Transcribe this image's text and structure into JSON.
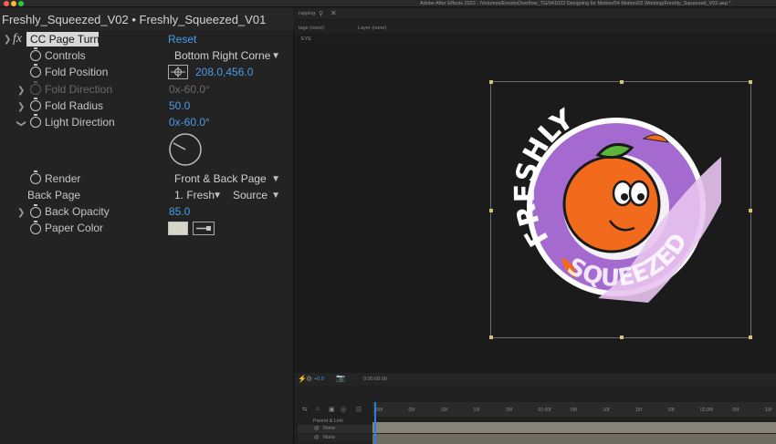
{
  "app_title": "Adobe After Effects 2023 - /Volumes/EnvatoOverflow_TG/041022 Designing for Motion/04 Motion/02 Working/Freshly_Squeezed_V02.aep *",
  "panel_title": "Freshly_Squeezed_V02 • Freshly_Squeezed_V01",
  "effect": {
    "fx_label": "fx",
    "name": "CC Page Turn",
    "reset": "Reset",
    "controls_label": "Controls",
    "controls_value": "Bottom Right Corne",
    "fold_position_label": "Fold Position",
    "fold_position_value": "208.0,456.0",
    "fold_direction_label": "Fold Direction",
    "fold_direction_value": "0x-60.0°",
    "fold_radius_label": "Fold Radius",
    "fold_radius_value": "50.0",
    "light_direction_label": "Light Direction",
    "light_direction_value": "0x-60.0°",
    "render_label": "Render",
    "render_value": "Front & Back Page",
    "back_page_label": "Back Page",
    "back_page_layer": "1. Fresh",
    "back_page_source": "Source",
    "back_opacity_label": "Back Opacity",
    "back_opacity_value": "85.0",
    "paper_color_label": "Paper Color"
  },
  "comp": {
    "tab_label": "rapping",
    "sub_left": "tage (none)",
    "sub_right": "Layer (none)",
    "eye_label": "EYE",
    "sticker_text_top": "FRESHLY",
    "sticker_text_bottom": "SQUEEZED",
    "zoom_value": "+0.0",
    "timecode": "0:00:00:00"
  },
  "timeline": {
    "ticks": [
      "00f",
      "05f",
      "10f",
      "15f",
      "20f",
      "01:00f",
      "05f",
      "10f",
      "15f",
      "20f",
      "02:00f",
      "05f",
      "10f"
    ],
    "parent_label": "Parent & Link",
    "parent_value_1": "None",
    "parent_value_2": "None"
  },
  "colors": {
    "accent_blue": "#4a9be8",
    "sticker_purple": "#a56ad0",
    "orange": "#f26b1d",
    "leaf_green": "#5bb43c"
  }
}
